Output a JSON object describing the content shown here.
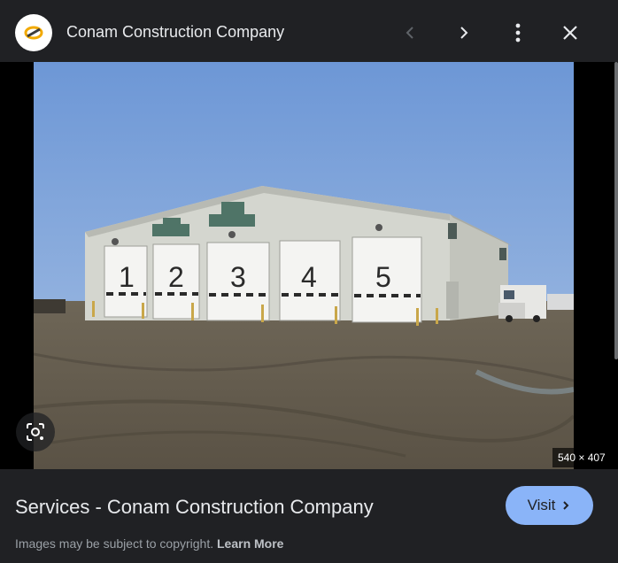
{
  "header": {
    "site_name": "Conam Construction Company",
    "icons": [
      "site-logo",
      "chevron-left-icon",
      "chevron-right-icon",
      "more-vert-icon",
      "close-icon"
    ]
  },
  "image": {
    "door_numbers": [
      "1",
      "2",
      "3",
      "4",
      "5"
    ],
    "dimensions_label": "540 × 407",
    "icons": [
      "lens-search-icon"
    ]
  },
  "footer": {
    "title": "Services - Conam Construction Company",
    "visit_label": "Visit",
    "copyright_text": "Images may be subject to copyright.",
    "learn_more_label": "Learn More"
  },
  "colors": {
    "background": "#202124",
    "text": "#e8eaed",
    "accent": "#8ab4f8",
    "muted": "#9aa0a6",
    "logo_ring": "#f2a900"
  }
}
